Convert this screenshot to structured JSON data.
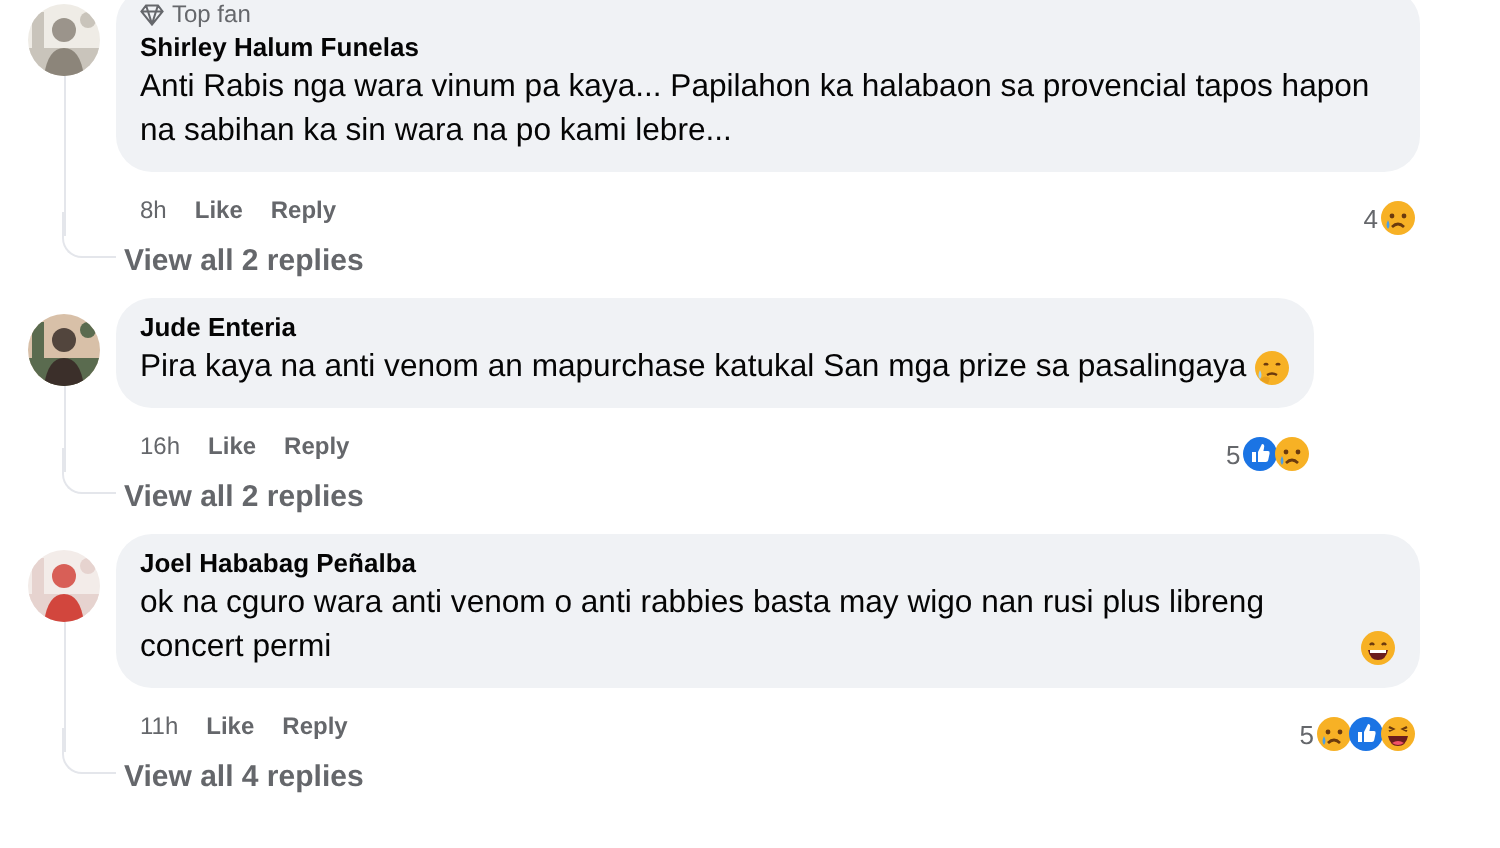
{
  "comments": [
    {
      "badge": "Top fan",
      "name": "Shirley Halum Funelas",
      "text": "Anti Rabis nga wara vinum pa kaya... Papilahon ka halabaon sa provencial tapos hapon na sabihan ka sin wara na po kami lebre...",
      "time": "8h",
      "like": "Like",
      "reply": "Reply",
      "reaction_count": "4",
      "reactions": [
        {
          "kind": "sad"
        }
      ],
      "replies_link": "View all 2 replies"
    },
    {
      "name": "Jude Enteria",
      "text": "Pira kaya na anti venom an mapurchase katukal San mga prize sa pasalingaya",
      "emoji": {
        "kind": "tearful"
      },
      "time": "16h",
      "like": "Like",
      "reply": "Reply",
      "reaction_count": "5",
      "reactions": [
        {
          "kind": "like"
        },
        {
          "kind": "sad"
        }
      ],
      "replies_link": "View all 2 replies"
    },
    {
      "name": "Joel Hababag Peñalba",
      "text": "ok na cguro wara anti venom o anti rabbies basta may wigo nan rusi plus libreng concert permi",
      "emoji": {
        "kind": "laugh"
      },
      "time": "11h",
      "like": "Like",
      "reply": "Reply",
      "reaction_count": "5",
      "reactions": [
        {
          "kind": "sad"
        },
        {
          "kind": "like"
        },
        {
          "kind": "haha"
        }
      ],
      "replies_link": "View all 4 replies"
    }
  ]
}
